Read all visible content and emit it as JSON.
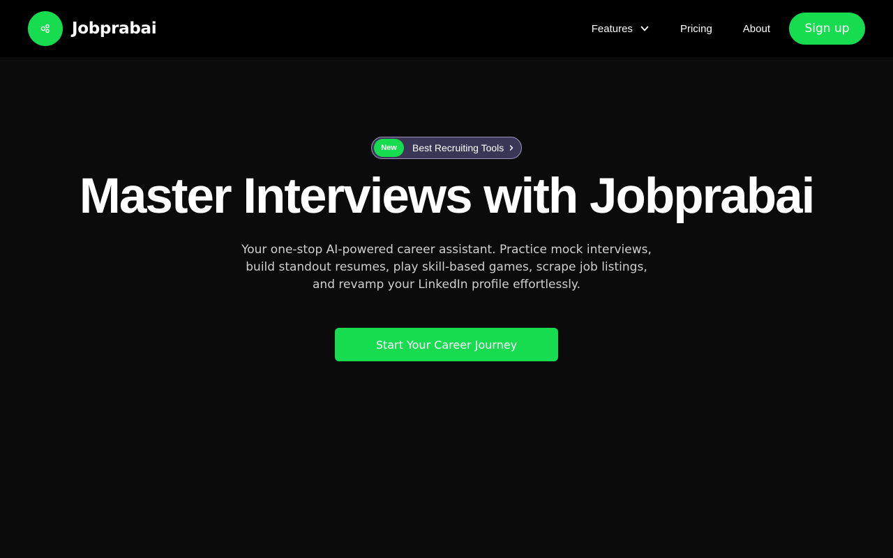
{
  "navbar": {
    "brand": {
      "name": "Jobprabai",
      "logo_icon": "molecule-icon",
      "logo_color": "#17dc4f"
    },
    "links": {
      "features": "Features",
      "pricing": "Pricing",
      "about": "About"
    },
    "features_icon": "chevron-down-icon",
    "signup_label": "Sign up"
  },
  "hero": {
    "pill": {
      "badge": "New",
      "text": "Best Recruiting Tools",
      "icon": "chevron-right-icon"
    },
    "title": "Master Interviews with Jobprabai",
    "subtitle": "Your one-stop AI-powered career assistant. Practice mock interviews, build standout resumes, play skill-based games, scrape job listings, and revamp your LinkedIn profile effortlessly.",
    "cta_label": "Start Your Career Journey"
  },
  "colors": {
    "accent": "#17dc4f",
    "nav_background": "#000000",
    "page_background": "#0b0b0b",
    "pill_background": "#3a3656"
  }
}
